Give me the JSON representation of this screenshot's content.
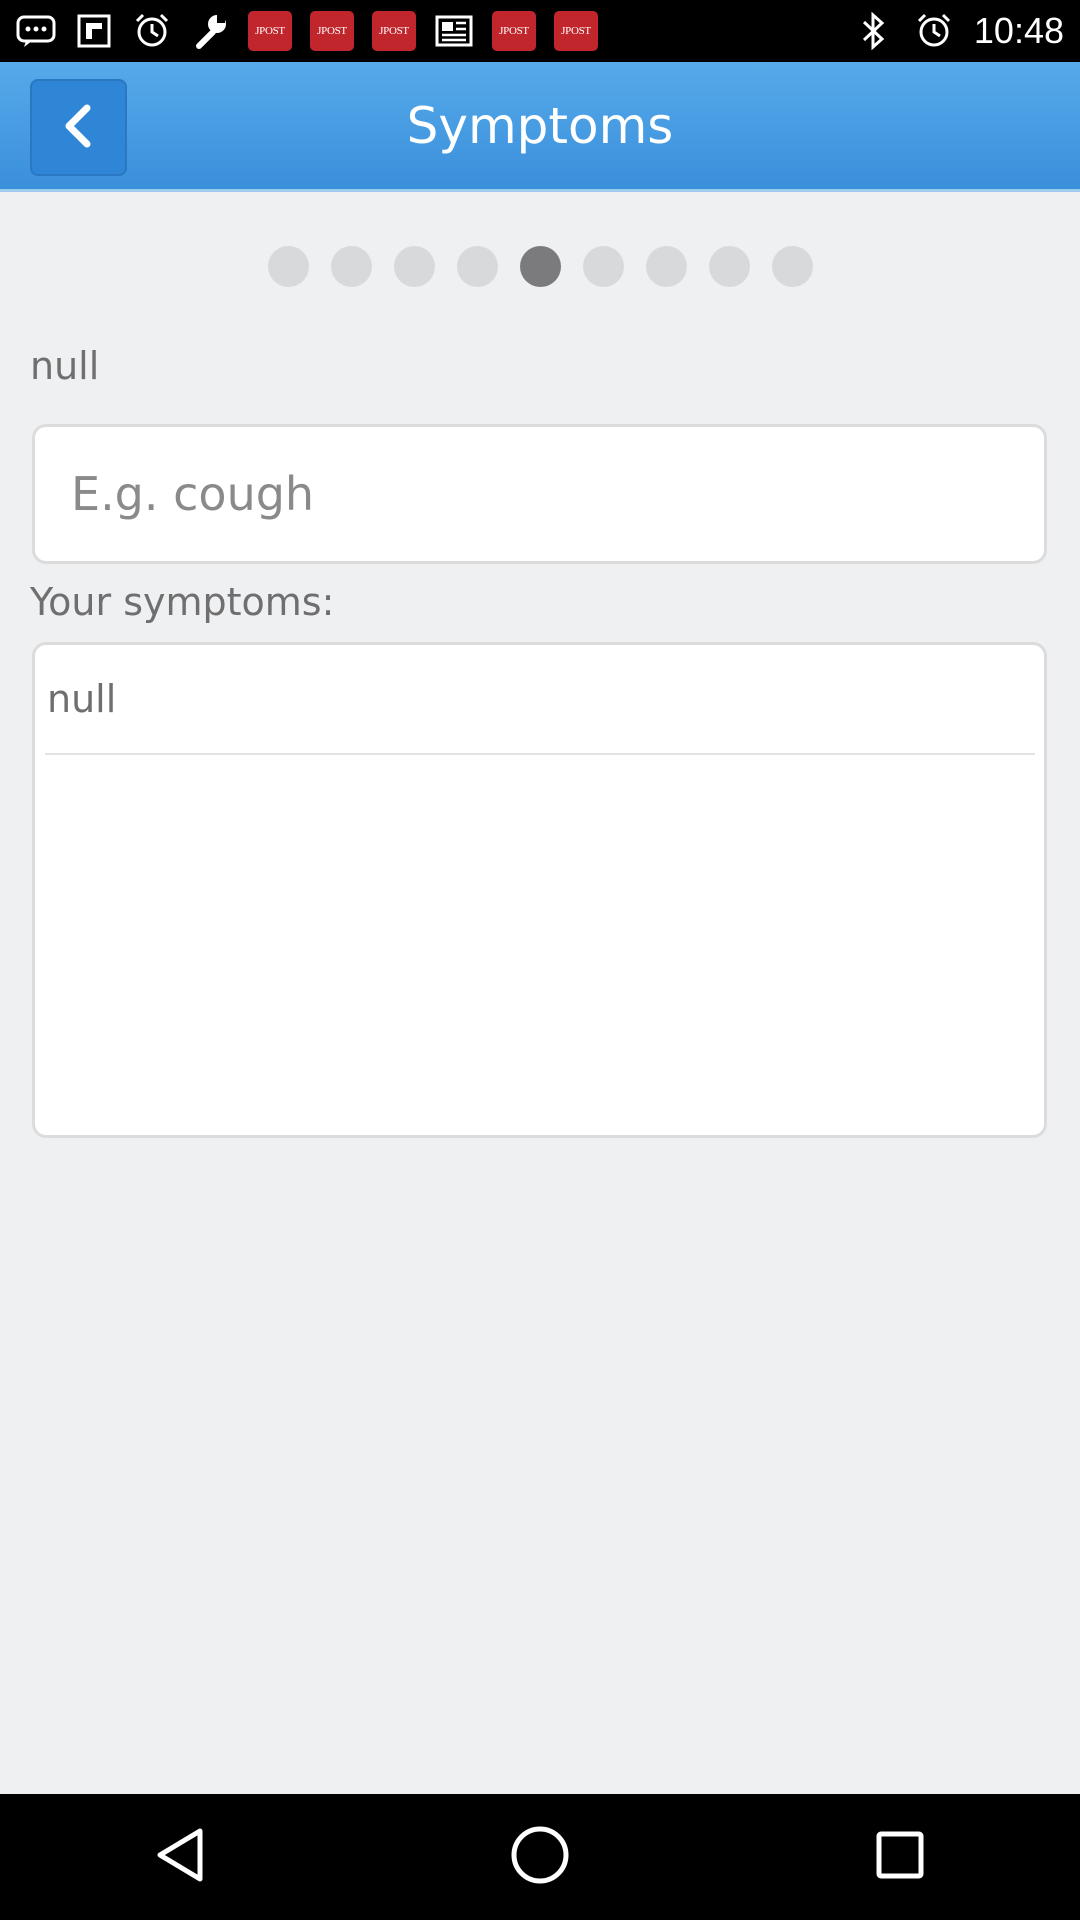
{
  "status_bar": {
    "time": "10:48",
    "notification_icons": [
      "messages-icon",
      "flipboard-icon",
      "alarm-icon",
      "wrench-icon",
      "jpost-icon",
      "jpost-icon",
      "jpost-icon",
      "news-icon",
      "jpost-icon",
      "jpost-icon"
    ],
    "jpost_label": "JPOST",
    "system_icons": [
      "bluetooth-icon",
      "alarm-icon"
    ]
  },
  "app_bar": {
    "title": "Symptoms",
    "back_icon": "chevron-left-icon"
  },
  "pager": {
    "total": 9,
    "active_index": 4
  },
  "form": {
    "field_label": "null",
    "symptom_input": {
      "placeholder": "E.g. cough",
      "value": ""
    },
    "symptoms_label": "Your symptoms:",
    "symptoms_list": [
      "null"
    ]
  },
  "nav_bar": {
    "buttons": [
      "back-icon",
      "home-icon",
      "recents-icon"
    ]
  },
  "colors": {
    "app_bar": "#3f94de",
    "back_button": "#2f86d6",
    "active_dot": "#7b7b7d",
    "inactive_dot": "#d8d9db",
    "background": "#eff0f2"
  }
}
